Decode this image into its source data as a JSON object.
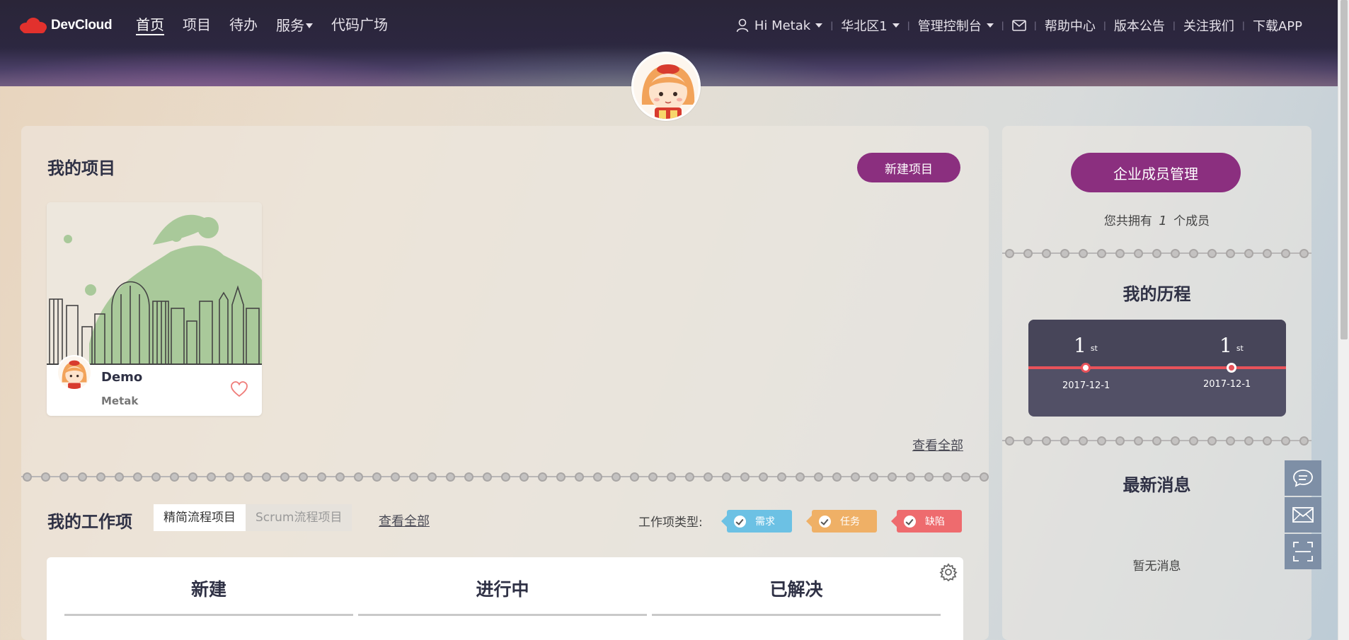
{
  "brand": {
    "name": "DevCloud",
    "logo_color": "#e2312d"
  },
  "nav": {
    "items": [
      {
        "label": "首页",
        "active": true
      },
      {
        "label": "项目",
        "active": false
      },
      {
        "label": "待办",
        "active": false
      },
      {
        "label": "服务",
        "active": false
      },
      {
        "label": "代码广场",
        "active": false
      }
    ]
  },
  "usernav": {
    "greeting": "Hi Metak",
    "region": "华北区1",
    "console": "管理控制台",
    "mail_icon": "mail-icon",
    "help": "帮助中心",
    "release_notes": "版本公告",
    "follow": "关注我们",
    "download": "下载APP"
  },
  "projects": {
    "title": "我的项目",
    "new_button": "新建项目",
    "items": [
      {
        "name": "Demo",
        "owner": "Metak"
      }
    ],
    "view_all": "查看全部"
  },
  "workitems": {
    "title": "我的工作项",
    "tabs": [
      {
        "label": "精简流程项目",
        "active": true
      },
      {
        "label": "Scrum流程项目",
        "active": false
      }
    ],
    "view_all": "查看全部",
    "type_label": "工作项类型:",
    "types": [
      {
        "label": "需求",
        "color": "#6cc1e4"
      },
      {
        "label": "任务",
        "color": "#efb066"
      },
      {
        "label": "缺陷",
        "color": "#ee6b6e"
      }
    ],
    "columns": [
      "新建",
      "进行中",
      "已解决"
    ]
  },
  "members": {
    "button": "企业成员管理",
    "text_prefix": "您共拥有",
    "count": "1",
    "text_suffix": "个成员"
  },
  "history": {
    "title": "我的历程",
    "entries": [
      {
        "num": "1",
        "suffix": "st",
        "date": "2017-12-1"
      },
      {
        "num": "1",
        "suffix": "st",
        "date": "2017-12-1"
      }
    ]
  },
  "messages": {
    "title": "最新消息",
    "empty": "暂无消息"
  },
  "colors": {
    "accent": "#8b2f7f",
    "timeline_red": "#e8525a",
    "sidetool": "#7e8fa6"
  }
}
